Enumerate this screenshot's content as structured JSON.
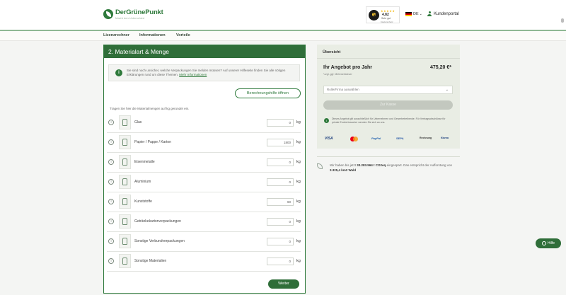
{
  "header": {
    "logo_name": "DerGrünePunkt",
    "logo_tag": "Macht den Unterschied",
    "trust": {
      "stars": "★★★★★",
      "score": "4.82",
      "label": "Sehr gut",
      "sub": "Käuferschutz"
    },
    "language": "DE",
    "portal": "Kundenportal"
  },
  "nav": {
    "items": [
      "Lizenzrechner",
      "Informationen",
      "Vorteile"
    ]
  },
  "card": {
    "title": "2. Materialart & Menge",
    "info_text": "Sie sind noch unsicher, welche Verpackungen Sie melden müssen? Auf unserer Hilfeseite finden Sie alle nötigen Erklärungen rund um diese Themen.",
    "info_link": "Mehr Informationen",
    "calc_button": "Berechnungshilfe öffnen",
    "hint": "Tragen Sie hier die Materialmengen auf kg gerundet ein.",
    "unit": "kg",
    "next_button": "Weiter",
    "rows": [
      {
        "label": "Glas",
        "value": "0"
      },
      {
        "label": "Papier / Pappe / Karton",
        "value": "1800"
      },
      {
        "label": "Eisenmetalle",
        "value": "0"
      },
      {
        "label": "Aluminium",
        "value": "0"
      },
      {
        "label": "Kunststoffe",
        "value": "60"
      },
      {
        "label": "Getränkekartonverpackungen",
        "value": "0"
      },
      {
        "label": "Sonstige Verbundverpackungen",
        "value": "0"
      },
      {
        "label": "Sonstige Materialien",
        "value": "0"
      }
    ]
  },
  "summary": {
    "title": "Übersicht",
    "offer_label": "Ihr Angebot pro Jahr",
    "price": "475,20 €*",
    "price_sub": "*zzgl. ggf. Mehrwertsteuer",
    "select_placeholder": "Rolle/Firma auswählen",
    "cart_button": "Zur Kasse",
    "note": "Dieses Angebot gilt ausschließlich für Unternehmen und Gewerbetreibende. Für Vertragsabschlüsse für private Endverbraucher wenden Sie sich an uns.",
    "payments": [
      "VISA",
      "Mastercard",
      "PayPal",
      "SEPA",
      "Rechnung",
      "Klarna"
    ]
  },
  "co2": {
    "prefix": "Wir haben bis jetzt",
    "amount": "33.283.564 t CO2eq",
    "middle": "eingespart. Das entspricht der Aufforstung von",
    "area": "3.325,4 km2 Wald"
  },
  "help_button": "Hilfe"
}
